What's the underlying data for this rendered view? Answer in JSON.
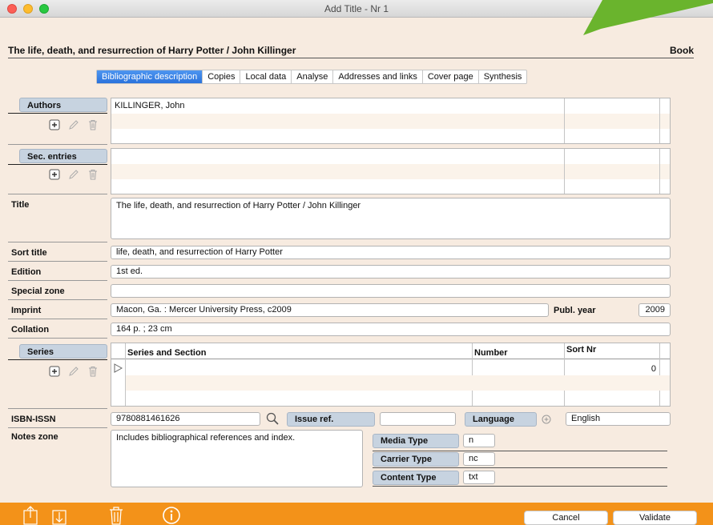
{
  "window": {
    "title": "Add Title - Nr 1"
  },
  "record": {
    "title": "The life, death, and resurrection of Harry Potter / John Killinger",
    "type": "Book"
  },
  "tabs": [
    {
      "label": "Bibliographic description",
      "active": true
    },
    {
      "label": "Copies"
    },
    {
      "label": "Local data"
    },
    {
      "label": "Analyse"
    },
    {
      "label": "Addresses and links"
    },
    {
      "label": "Cover page"
    },
    {
      "label": "Synthesis"
    }
  ],
  "authors": {
    "label": "Authors",
    "rows": [
      "KILLINGER, John"
    ]
  },
  "sec_entries": {
    "label": "Sec. entries"
  },
  "title_field": {
    "label": "Title",
    "value": "The life, death, and resurrection of Harry Potter / John Killinger"
  },
  "sort_title": {
    "label": "Sort title",
    "value": "life, death, and resurrection of Harry Potter"
  },
  "edition": {
    "label": "Edition",
    "value": "1st ed."
  },
  "special_zone": {
    "label": "Special zone",
    "value": ""
  },
  "imprint": {
    "label": "Imprint",
    "value": "Macon, Ga. : Mercer University Press, c2009",
    "year_label": "Publ. year",
    "year": "2009"
  },
  "collation": {
    "label": "Collation",
    "value": "164 p. ; 23 cm"
  },
  "series": {
    "label": "Series",
    "columns": [
      "Series and Section",
      "Number",
      "Sort Nr"
    ],
    "rows": [
      {
        "series": "",
        "number": "",
        "sort_nr": "0"
      }
    ]
  },
  "isbn": {
    "label": "ISBN-ISSN",
    "value": "9780881461626"
  },
  "issue_ref": {
    "label": "Issue ref.",
    "value": ""
  },
  "language": {
    "label": "Language",
    "value": "English"
  },
  "notes": {
    "label": "Notes zone",
    "value": "Includes bibliographical references and index."
  },
  "media_type": {
    "label": "Media Type",
    "value": "n"
  },
  "carrier_type": {
    "label": "Carrier Type",
    "value": "nc"
  },
  "content_type": {
    "label": "Content Type",
    "value": "txt"
  },
  "footer": {
    "cancel": "Cancel",
    "validate": "Validate"
  },
  "colors": {
    "accent": "#f39219",
    "tab_active": "#2a73dc",
    "label_bg": "#c7d3e0",
    "window_bg": "#f7ebe0"
  },
  "icons": [
    "add-icon",
    "edit-pencil-icon",
    "trash-icon",
    "search-icon",
    "upload-icon",
    "download-icon",
    "info-icon"
  ]
}
